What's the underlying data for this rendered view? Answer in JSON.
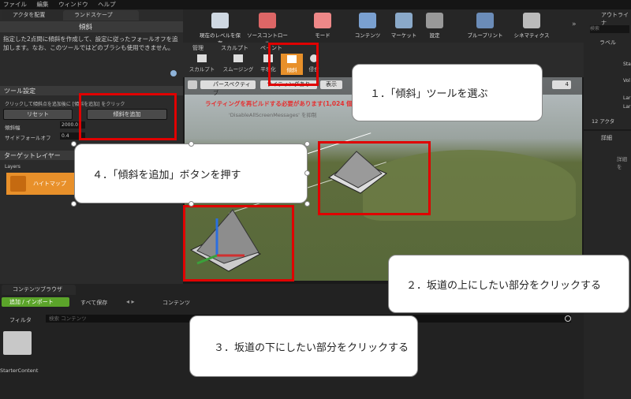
{
  "menu": [
    "ファイル",
    "編集",
    "ウィンドウ",
    "ヘルプ"
  ],
  "left_tabs": {
    "place_actors": "アクタを配置",
    "landscape": "ランドスケープ"
  },
  "tool_title": "傾斜",
  "description": "指定した2点間に傾斜を作成して、設定に従ったフォールオフを追加します。なお、このツールではどのブラシも使用できません。",
  "tool_settings": {
    "header": "ツール設定",
    "hint": "クリックして傾斜点を追加後に [傾斜を追加] をクリック",
    "reset_label": "リセット",
    "add_ramp_label": "傾斜を追加",
    "width_label": "傾斜幅",
    "width_value": "2000.0",
    "falloff_label": "サイドフォールオフ",
    "falloff_value": "0.4"
  },
  "target_layers": {
    "header": "ターゲットレイヤー",
    "sub": "Layers",
    "heightmap": "ハイトマップ"
  },
  "toolbar": [
    "現在のレベルを保存",
    "ソースコントロール",
    "モード",
    "コンテンツ",
    "マーケット",
    "設定",
    "ブループリント",
    "シネマティクス"
  ],
  "mode_tabs": [
    "管理",
    "スカルプト",
    "ペイント"
  ],
  "sculpt_tools": [
    "スカルプト",
    "スムージング",
    "平坦化",
    "傾斜",
    "侵食"
  ],
  "viewport": {
    "perspective": "パースペクティブ",
    "lit": "ライティングあり",
    "show": "表示",
    "warning": "ライティングを再ビルドする必要があります(1,024 個",
    "hint": "'DisableAllScreenMessages' を抑制",
    "speed": "4"
  },
  "outliner": {
    "title": "アウトライナ",
    "search": "検索",
    "col_label": "ラベル",
    "count": "12 アクタ",
    "items": [
      "Sta",
      "Vol",
      "Lar",
      "Lar"
    ]
  },
  "details": {
    "title": "詳細",
    "body": "詳細を"
  },
  "content_browser": {
    "tab": "コンテンツブラウザ",
    "add_import": "追加 / インポート",
    "save_all": "すべて保存",
    "path": "コンテンツ",
    "filter": "フィルタ",
    "search_placeholder": "検索 コンテンツ",
    "folder": "StarterContent"
  },
  "callouts": {
    "step1": "１．「傾斜」ツールを選ぶ",
    "step2": "２．坂道の上にしたい部分をクリックする",
    "step3": "３．坂道の下にしたい部分をクリックする",
    "step4": "４．「傾斜を追加」ボタンを押す"
  },
  "colors": {
    "annotation_red": "#e00000",
    "active_tool": "#e8902a",
    "accent_green": "#5ba42a"
  }
}
